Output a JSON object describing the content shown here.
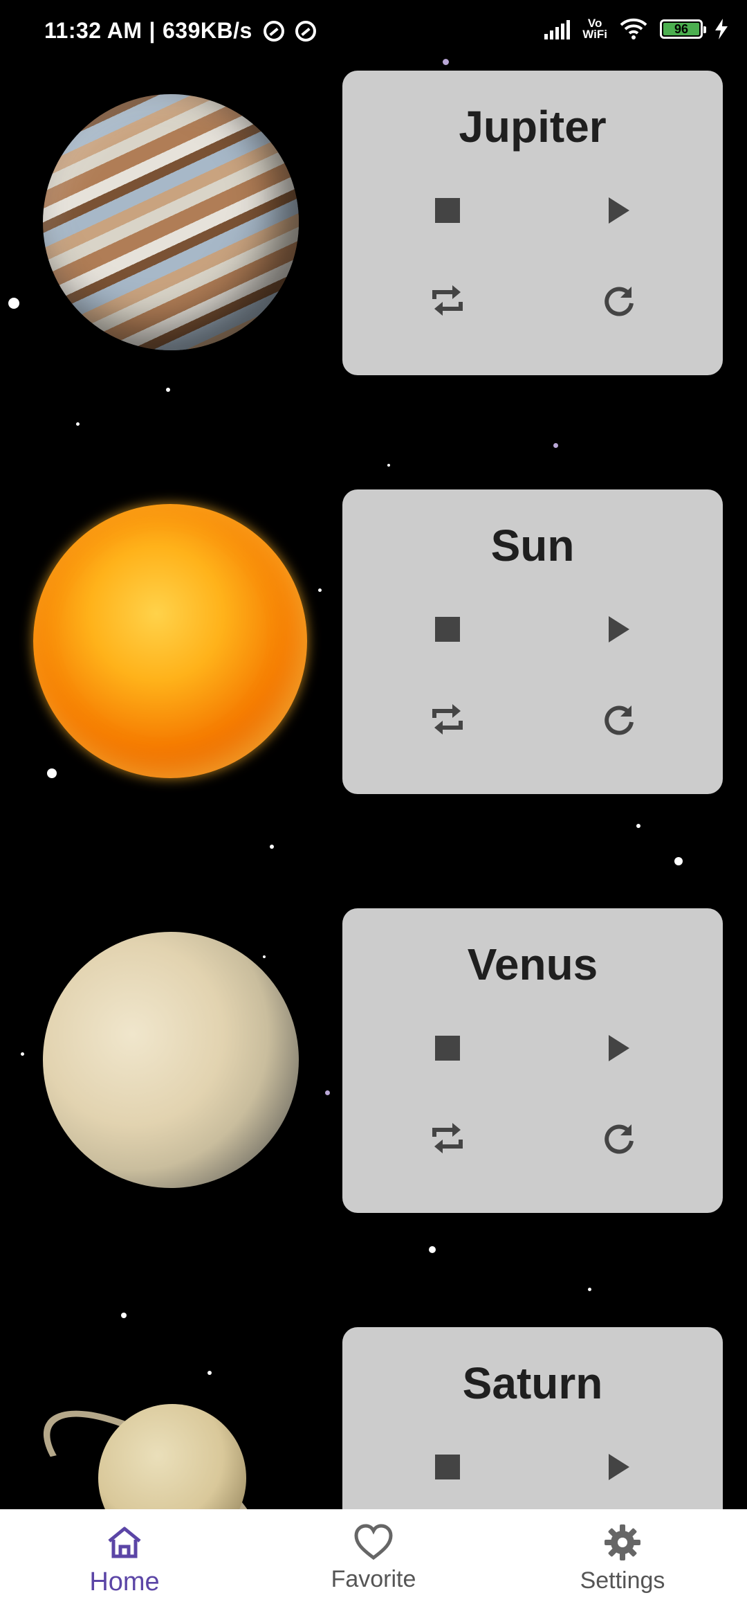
{
  "status_bar": {
    "time": "11:32 AM",
    "network_speed": "639KB/s",
    "vowifi_top": "Vo",
    "vowifi_bottom": "WiFi",
    "battery": "96"
  },
  "planets": [
    {
      "name": "Jupiter"
    },
    {
      "name": "Sun"
    },
    {
      "name": "Venus"
    },
    {
      "name": "Saturn"
    }
  ],
  "controls": {
    "stop_icon": "stop-icon",
    "play_icon": "play-icon",
    "loop_icon": "repeat-icon",
    "replay_icon": "replay-icon"
  },
  "bottom_nav": {
    "items": [
      {
        "label": "Home",
        "icon": "home-icon",
        "active": true
      },
      {
        "label": "Favorite",
        "icon": "heart-icon",
        "active": false
      },
      {
        "label": "Settings",
        "icon": "gear-icon",
        "active": false
      }
    ]
  },
  "colors": {
    "background": "#000000",
    "card": "#cccccc",
    "accent": "#5b45a6",
    "battery": "#4caf50"
  }
}
